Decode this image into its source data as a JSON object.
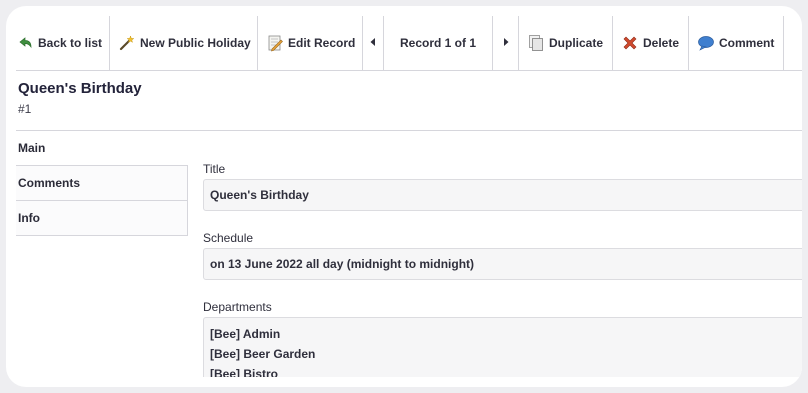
{
  "toolbar": {
    "back_label": "Back to list",
    "new_label": "New Public Holiday",
    "edit_label": "Edit Record",
    "record_counter": "Record 1 of 1",
    "duplicate_label": "Duplicate",
    "delete_label": "Delete",
    "comment_label": "Comment",
    "icons": [
      "undo-arrow-icon",
      "magic-wand-icon",
      "pencil-document-icon",
      "caret-left-icon",
      "caret-right-icon",
      "copy-document-icon",
      "red-x-icon",
      "speech-bubble-icon"
    ]
  },
  "record": {
    "title": "Queen's Birthday",
    "id": "#1"
  },
  "tabs": [
    {
      "label": "Main"
    },
    {
      "label": "Comments"
    },
    {
      "label": "Info"
    }
  ],
  "fields": {
    "title_label": "Title",
    "title_value": "Queen's Birthday",
    "schedule_label": "Schedule",
    "schedule_value": "on 13 June 2022 all day (midnight to midnight)",
    "departments_label": "Departments",
    "departments": [
      "[Bee] Admin",
      "[Bee] Beer Garden",
      "[Bee] Bistro"
    ]
  },
  "colors": {
    "undo_green": "#3f8f3f",
    "delete_red": "#d04a2e",
    "comment_blue": "#3f7fcf"
  }
}
